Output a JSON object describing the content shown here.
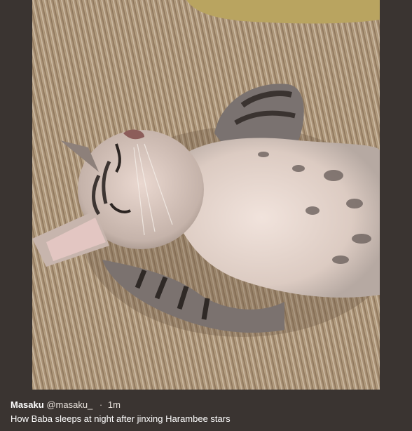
{
  "tweet": {
    "author_name": "Masaku",
    "handle": "@masaku_",
    "separator": "·",
    "time": "1m",
    "text": "How Baba sleeps at night after jinxing Harambee stars"
  },
  "colors": {
    "frame_background": "#3a3431",
    "text": "#ffffff"
  },
  "icons": [
    "cat-photo"
  ]
}
